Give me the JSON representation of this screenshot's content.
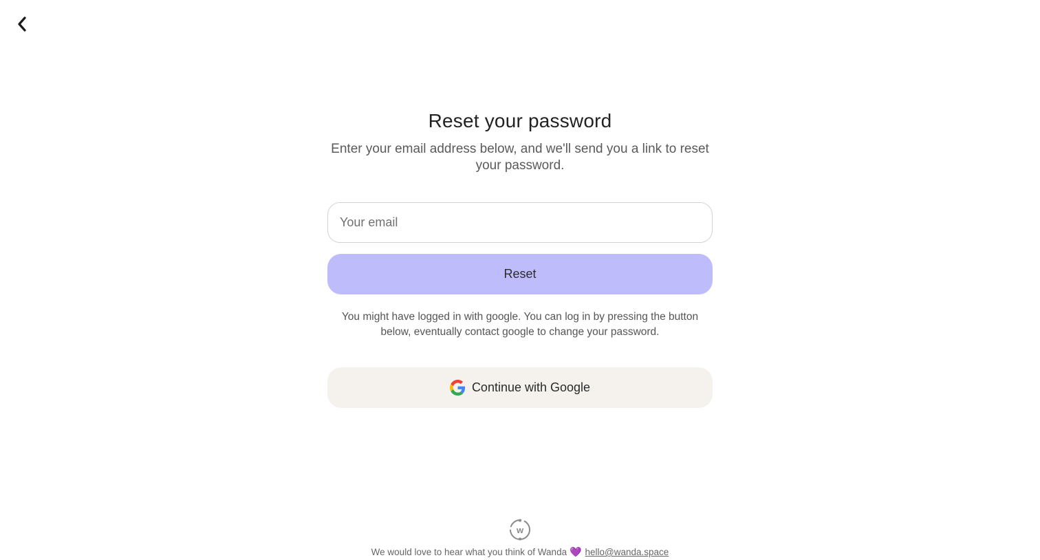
{
  "header": {
    "back_icon": "chevron-left-icon"
  },
  "main": {
    "title": "Reset your password",
    "subtitle": "Enter your email address below, and we'll send you a link to reset your password.",
    "email": {
      "placeholder": "Your email",
      "value": ""
    },
    "reset_label": "Reset",
    "hint": "You might have logged in with google. You can log in by pressing the button below, eventually contact google to change your password.",
    "google_label": "Continue with Google",
    "google_icon": "google-g-icon"
  },
  "footer": {
    "logo_icon": "wanda-logo-icon",
    "logo_letter": "w",
    "message": "We would love to hear what you think of Wanda",
    "heart": "💜",
    "email_link": "hello@wanda.space"
  },
  "colors": {
    "accent": "#bfbcfb",
    "google_button_bg": "#f5f2ed",
    "heart": "#9b3fe0"
  }
}
